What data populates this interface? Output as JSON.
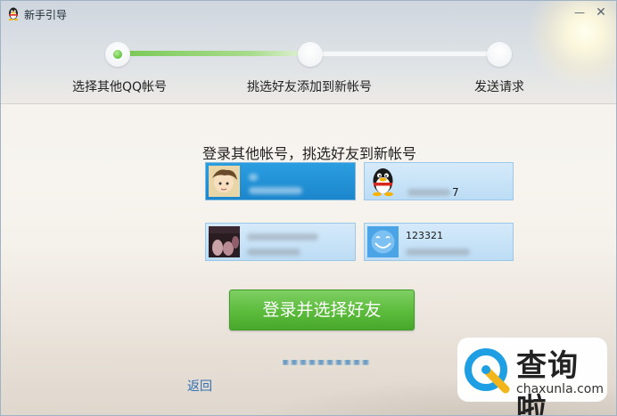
{
  "window": {
    "title": "新手引导",
    "minimize_icon": "minimize-icon",
    "close_icon": "close-icon"
  },
  "progress": {
    "completed_fraction": 0.5,
    "steps": [
      {
        "label": "选择其他QQ帐号",
        "state": "current"
      },
      {
        "label": "挑选好友添加到新帐号",
        "state": "pending"
      },
      {
        "label": "发送请求",
        "state": "pending"
      }
    ]
  },
  "main": {
    "heading": "登录其他帐号，挑选好友到新帐号",
    "accounts": [
      {
        "name": "",
        "avatar": "cartoon-avatar",
        "selected": true
      },
      {
        "name": "7",
        "avatar": "qq-penguin-avatar",
        "selected": false
      },
      {
        "name": "",
        "avatar": "dark-photo-avatar",
        "selected": false
      },
      {
        "name": "123321",
        "avatar": "blue-smile-avatar",
        "selected": false
      }
    ],
    "login_button": "登录并选择好友",
    "back_link": "返回"
  },
  "watermark": {
    "text": "查询啦",
    "url": "chaxunla.com"
  },
  "colors": {
    "accent_green": "#5bbb3b",
    "selected_blue": "#1c86cc",
    "card_blue": "#bcdcf5",
    "link_blue": "#2f6fb4"
  }
}
